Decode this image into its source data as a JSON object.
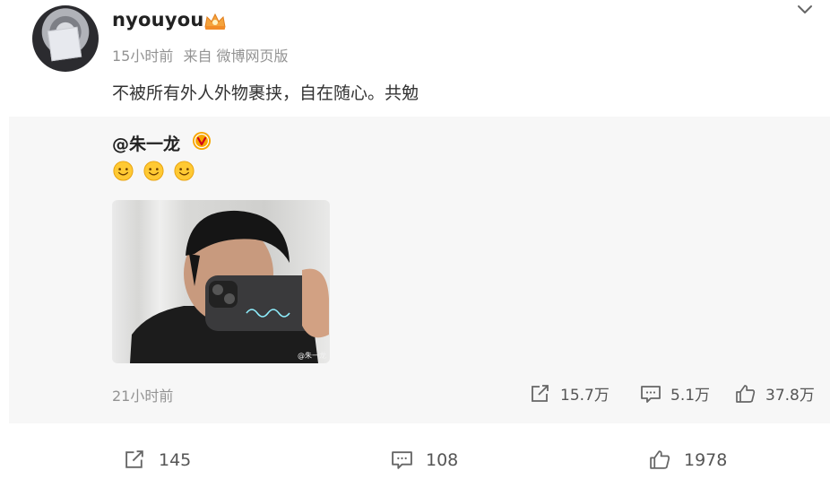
{
  "post": {
    "username": "nyouyou",
    "time": "15小时前",
    "source": "来自 微博网页版",
    "text": "不被所有外人外物裹挟，自在随心。共勉"
  },
  "repost": {
    "original_user": "@朱一龙",
    "emojis": [
      "smile-emoji",
      "smile-emoji",
      "smile-emoji"
    ],
    "image_watermark": "@朱一龙",
    "time": "21小时前",
    "reposts": "15.7万",
    "comments": "5.1万",
    "likes": "37.8万"
  },
  "actions": {
    "reposts": "145",
    "comments": "108",
    "likes": "1978"
  },
  "colors": {
    "meta_text": "#939393",
    "repost_background": "#f7f7f7",
    "verify_badge": "#f7a600",
    "emoji": "#ffc933"
  }
}
